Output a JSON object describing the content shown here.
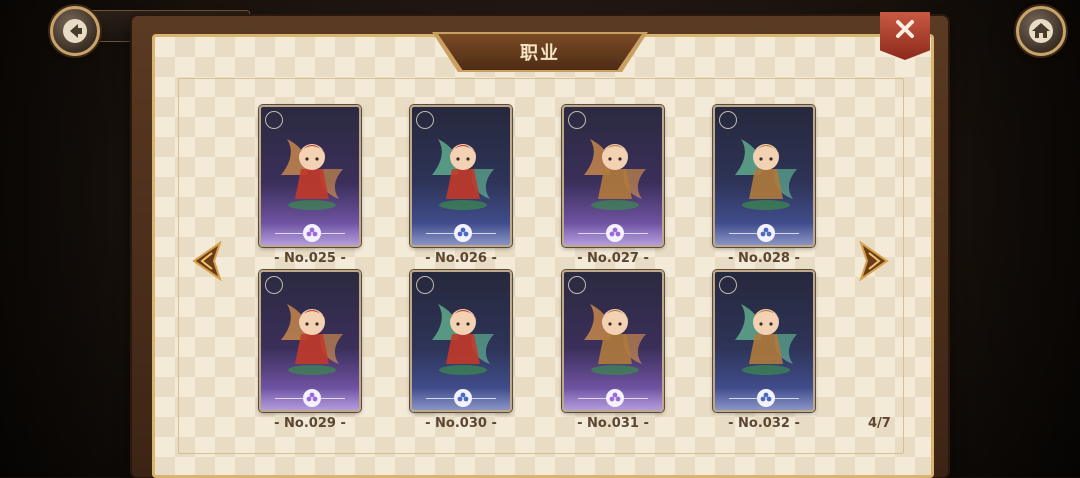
{
  "header": {
    "title": "职业",
    "top_tab_text": ""
  },
  "colors": {
    "frame": "#5a3a22",
    "parchment": "#f3ead7",
    "gold": "#d9b46e",
    "close": "#b64530",
    "label": "#5b4634"
  },
  "icons": {
    "back": "back-arrow-icon",
    "home": "home-icon",
    "close": "close-x-icon",
    "prev": "prev-arrow-icon",
    "next": "next-arrow-icon"
  },
  "cards": [
    {
      "label": "- No.025 -",
      "tone": "purple"
    },
    {
      "label": "- No.026 -",
      "tone": "blue"
    },
    {
      "label": "- No.027 -",
      "tone": "purple"
    },
    {
      "label": "- No.028 -",
      "tone": "blue"
    },
    {
      "label": "- No.029 -",
      "tone": "purple"
    },
    {
      "label": "- No.030 -",
      "tone": "blue"
    },
    {
      "label": "- No.031 -",
      "tone": "purple"
    },
    {
      "label": "- No.032 -",
      "tone": "blue"
    }
  ],
  "pagination": {
    "text": "4/7"
  }
}
